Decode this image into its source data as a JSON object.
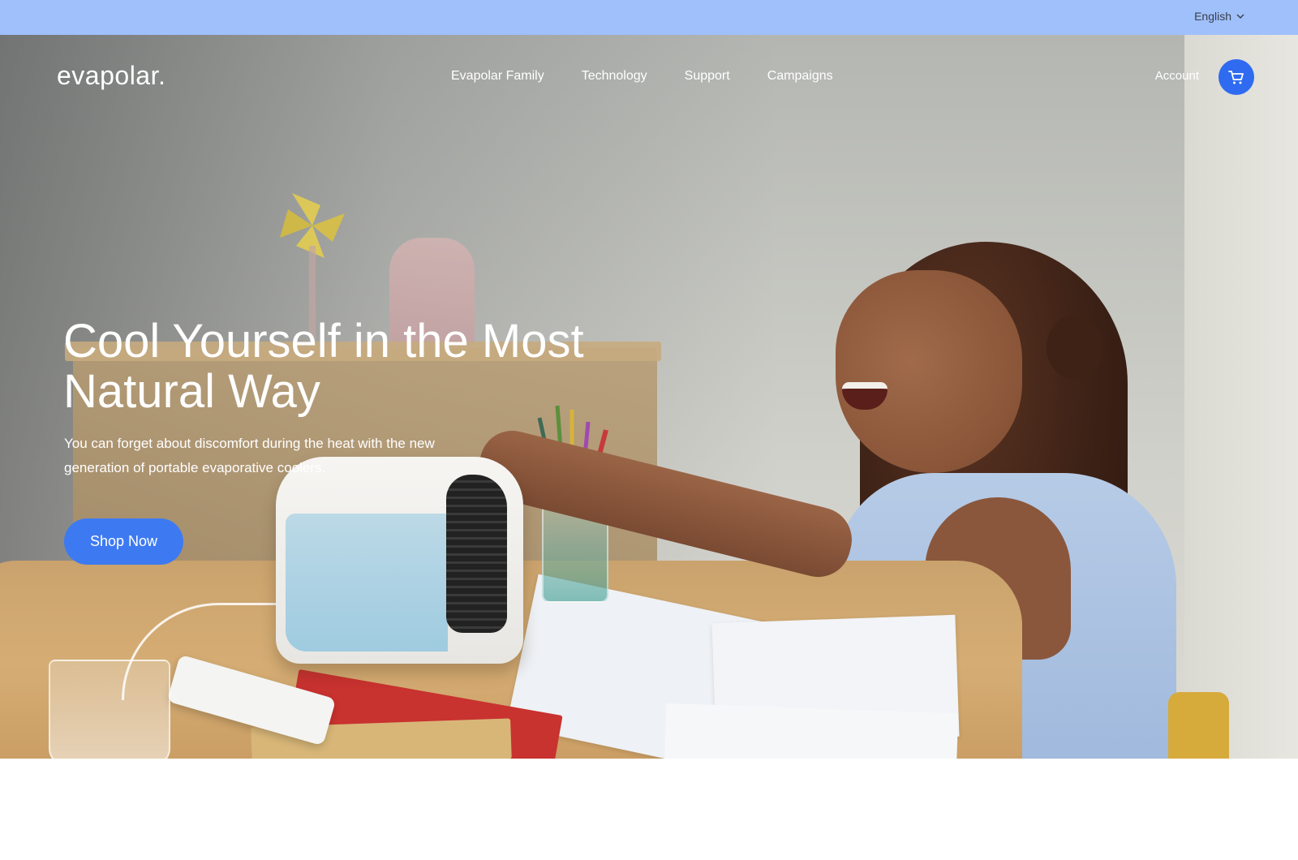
{
  "topbar": {
    "language": "English"
  },
  "header": {
    "logo": "evapolar.",
    "nav": [
      {
        "label": "Evapolar Family"
      },
      {
        "label": "Technology"
      },
      {
        "label": "Support"
      },
      {
        "label": "Campaigns"
      }
    ],
    "account": "Account"
  },
  "hero": {
    "title_line1": "Cool Yourself in the Most",
    "title_line2": "Natural Way",
    "subtitle": "You can forget about discomfort during the heat with the new generation of portable evaporative coolers.",
    "cta": "Shop Now"
  },
  "icons": {
    "cart": "cart-icon",
    "chevron": "chevron-down-icon"
  },
  "colors": {
    "topbar_bg": "#9fc0fb",
    "accent": "#3d7af2",
    "cart_bg": "#2f6bf0"
  }
}
